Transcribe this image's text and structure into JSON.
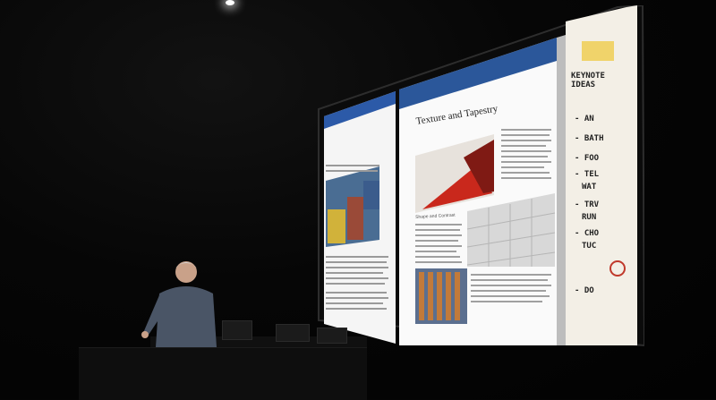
{
  "scene": {
    "description_text": "",
    "left_doc": {
      "snippet": ""
    },
    "middle_doc": {
      "title": "Texture and Tapestry",
      "section": "Shape and Contrast"
    },
    "notes_panel": {
      "lines": [
        "KEYNOTE IDEAS",
        "- AN",
        "- BATH",
        "- FOO",
        "- TEL",
        "WAT",
        "- TRV",
        "RUN",
        "- CHO",
        "TUC",
        "- DO"
      ]
    }
  }
}
